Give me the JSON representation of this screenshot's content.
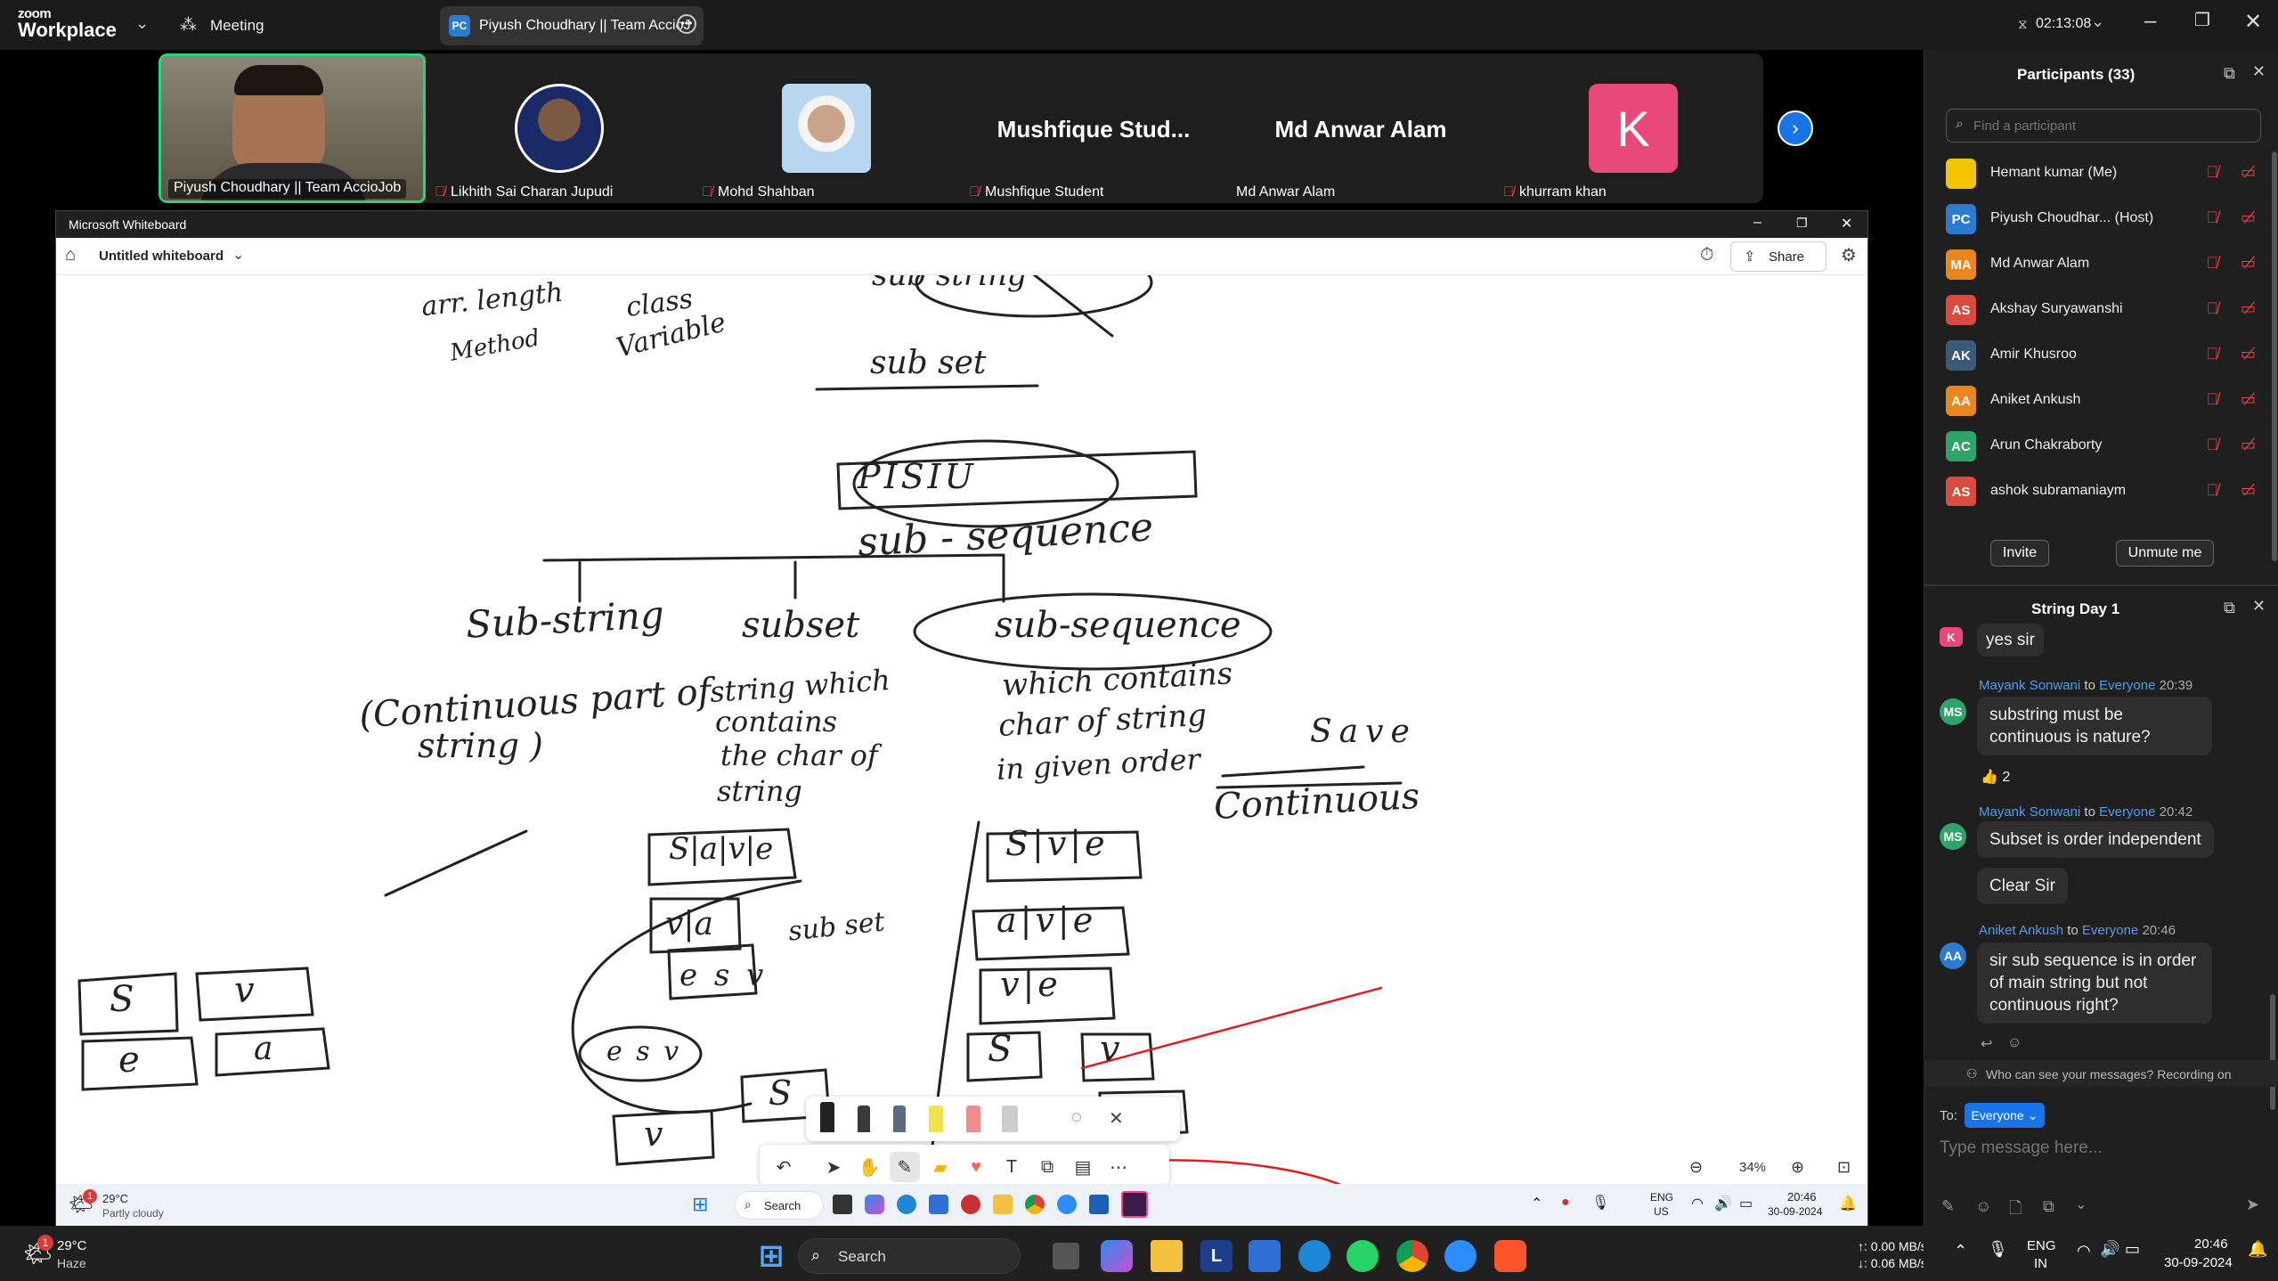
{
  "app": {
    "logo_top": "zoom",
    "logo_bottom": "Workplace",
    "meeting_label": "Meeting",
    "meeting_title": "Piyush Choudhary || Team AccioJ",
    "meeting_title_initials": "PC",
    "timer": "02:13:08"
  },
  "videos": [
    {
      "name": "Piyush Choudhary || Team AccioJob",
      "muted": false,
      "kind": "video"
    },
    {
      "name": "Likhith Sai Charan Jupudi",
      "muted": true,
      "kind": "photo"
    },
    {
      "name": "Mohd Shahban",
      "muted": true,
      "kind": "photo"
    },
    {
      "name": "Mushfique Student",
      "muted": true,
      "kind": "text",
      "big": "Mushfique  Stud..."
    },
    {
      "name": "Md Anwar Alam",
      "muted": false,
      "kind": "text",
      "big": "Md Anwar Alam"
    },
    {
      "name": "khurram khan",
      "muted": true,
      "kind": "letter",
      "big": "K"
    }
  ],
  "whiteboard": {
    "window_title": "Microsoft Whiteboard",
    "doc_title": "Untitled whiteboard",
    "share_label": "Share",
    "zoom_level": "34%",
    "handwriting": {
      "a1": "arr. length",
      "a2": "Method",
      "a3": "class",
      "a4": "Variable",
      "b1": "sub string",
      "b2": "sub set",
      "b3": "PISIU",
      "b4": "sub - sequence",
      "c1": "Sub-string",
      "c2": "subset",
      "c3": "sub-sequence",
      "d1": "(Continuous part of",
      "d2": "string )",
      "e1": "string which",
      "e2": "contains",
      "e3": "the char of",
      "e4": "string",
      "f1": "which contains",
      "f2": "char of string",
      "f3": "in given order",
      "g1": "Save",
      "g2": "Continuous",
      "h1": "S|a|v|e",
      "h2": "v|a",
      "h3": "e s v",
      "h4": "sub set",
      "h5": "e s v",
      "i1": "S|v|e",
      "i2": "a|v|e",
      "i3": "v|e",
      "i4": "S",
      "i5": "v",
      "i6": "a",
      "j1": "S",
      "j2": "v",
      "j3": "e",
      "j4": "a",
      "k1": "S",
      "k2": "v",
      "k3": "a"
    }
  },
  "inner_taskbar": {
    "weather_temp": "29°C",
    "weather_desc": "Partly cloudy",
    "search_label": "Search",
    "lang_top": "ENG",
    "lang_bottom": "US",
    "time": "20:46",
    "date": "30-09-2024",
    "badge": "1"
  },
  "taskbar": {
    "weather_temp": "29°C",
    "weather_desc": "Haze",
    "search_label": "Search",
    "net_up": "↑: 0.00 MB/s",
    "net_down": "↓: 0.06 MB/s",
    "lang_top": "ENG",
    "lang_bottom": "IN",
    "time": "20:46",
    "date": "30-09-2024",
    "badge": "1"
  },
  "participants": {
    "title": "Participants (33)",
    "search_placeholder": "Find a participant",
    "invite_label": "Invite",
    "unmute_label": "Unmute me",
    "list": [
      {
        "initials": "",
        "name": "Hemant kumar (Me)",
        "color": "#f5c400"
      },
      {
        "initials": "PC",
        "name": "Piyush Choudhar... (Host)",
        "color": "#2d7bd1"
      },
      {
        "initials": "MA",
        "name": "Md Anwar Alam",
        "color": "#e8871e"
      },
      {
        "initials": "AS",
        "name": "Akshay Suryawanshi",
        "color": "#d94b3f"
      },
      {
        "initials": "AK",
        "name": "Amir Khusroo",
        "color": "#3b5a7a"
      },
      {
        "initials": "AA",
        "name": "Aniket Ankush",
        "color": "#e8871e"
      },
      {
        "initials": "AC",
        "name": "Arun Chakraborty",
        "color": "#2ea36a"
      },
      {
        "initials": "AS",
        "name": "ashok subramaniaym",
        "color": "#d94b3f"
      }
    ]
  },
  "chat": {
    "title": "String Day 1",
    "m0": {
      "text": "yes sir",
      "avatar": "K"
    },
    "m1": {
      "sender": "Mayank Sonwani",
      "to": "to",
      "target": "Everyone",
      "time": "20:39",
      "avatar": "MS",
      "line1": "substring must be",
      "line2": "continuous is nature?",
      "reaction": "👍 2"
    },
    "m2": {
      "sender": "Mayank Sonwani",
      "to": "to",
      "target": "Everyone",
      "time": "20:42",
      "avatar": "MS",
      "line1": "Subset is order independent",
      "line2": "Clear Sir"
    },
    "m3": {
      "sender": "Aniket Ankush",
      "to": "to",
      "target": "Everyone",
      "time": "20:46",
      "avatar": "AA",
      "line1": "sir sub sequence is in order",
      "line2": "of main string but not",
      "line3": "continuous right?"
    },
    "visibility": "Who can see your messages? Recording on",
    "to_label": "To:",
    "to_value": "Everyone",
    "input_placeholder": "Type message here..."
  }
}
